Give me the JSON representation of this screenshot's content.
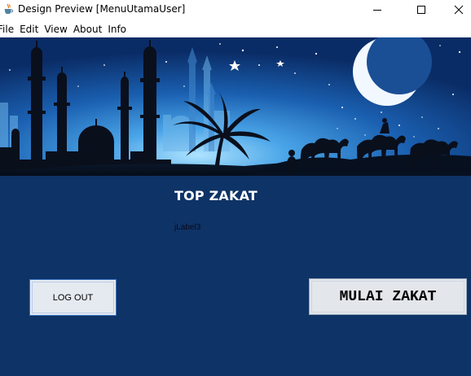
{
  "window": {
    "title": "Design Preview [MenuUtamaUser]",
    "icon": "java-cup-icon"
  },
  "menubar": {
    "items": [
      {
        "label": "File"
      },
      {
        "label": "Edit"
      },
      {
        "label": "View"
      },
      {
        "label": "About"
      },
      {
        "label": "Info"
      }
    ]
  },
  "content": {
    "background_color": "#0e3366",
    "banner": "mosque-crescent-camels-banner",
    "heading": "TOP ZAKAT",
    "label": "jLabel3",
    "logout_label": "LOG OUT",
    "mulai_label": "MULAI ZAKAT"
  }
}
